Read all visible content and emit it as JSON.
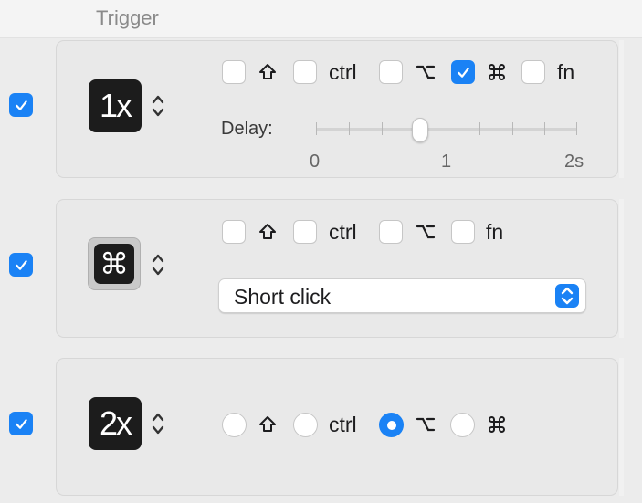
{
  "header": {
    "label": "Trigger"
  },
  "rows": [
    {
      "enabled": true,
      "trigger_icon": "1x",
      "modifiers": [
        {
          "name": "shift",
          "symbol": "⇧",
          "checked": false
        },
        {
          "name": "ctrl",
          "label": "ctrl",
          "checked": false
        },
        {
          "name": "option",
          "symbol": "⌥",
          "checked": false
        },
        {
          "name": "command",
          "symbol": "⌘",
          "checked": true
        },
        {
          "name": "fn",
          "label": "fn",
          "checked": false
        }
      ],
      "delay": {
        "label": "Delay:",
        "value": 0.8,
        "min_label": "0",
        "mid_label": "1",
        "max_label": "2s"
      }
    },
    {
      "enabled": true,
      "trigger_icon": "⌘",
      "modifiers": [
        {
          "name": "shift",
          "symbol": "⇧",
          "checked": false
        },
        {
          "name": "ctrl",
          "label": "ctrl",
          "checked": false
        },
        {
          "name": "option",
          "symbol": "⌥",
          "checked": false
        },
        {
          "name": "fn",
          "label": "fn",
          "checked": false
        }
      ],
      "click_type": {
        "selected": "Short click"
      }
    },
    {
      "enabled": true,
      "trigger_icon": "2x",
      "modifiers_radio": [
        {
          "name": "shift",
          "symbol": "⇧",
          "selected": false
        },
        {
          "name": "ctrl",
          "label": "ctrl",
          "selected": false
        },
        {
          "name": "option",
          "symbol": "⌥",
          "selected": true
        },
        {
          "name": "command",
          "symbol": "⌘",
          "selected": false
        }
      ]
    }
  ],
  "colors": {
    "accent": "#1a82f5",
    "panel": "#e9e9e9",
    "background": "#ececec"
  }
}
